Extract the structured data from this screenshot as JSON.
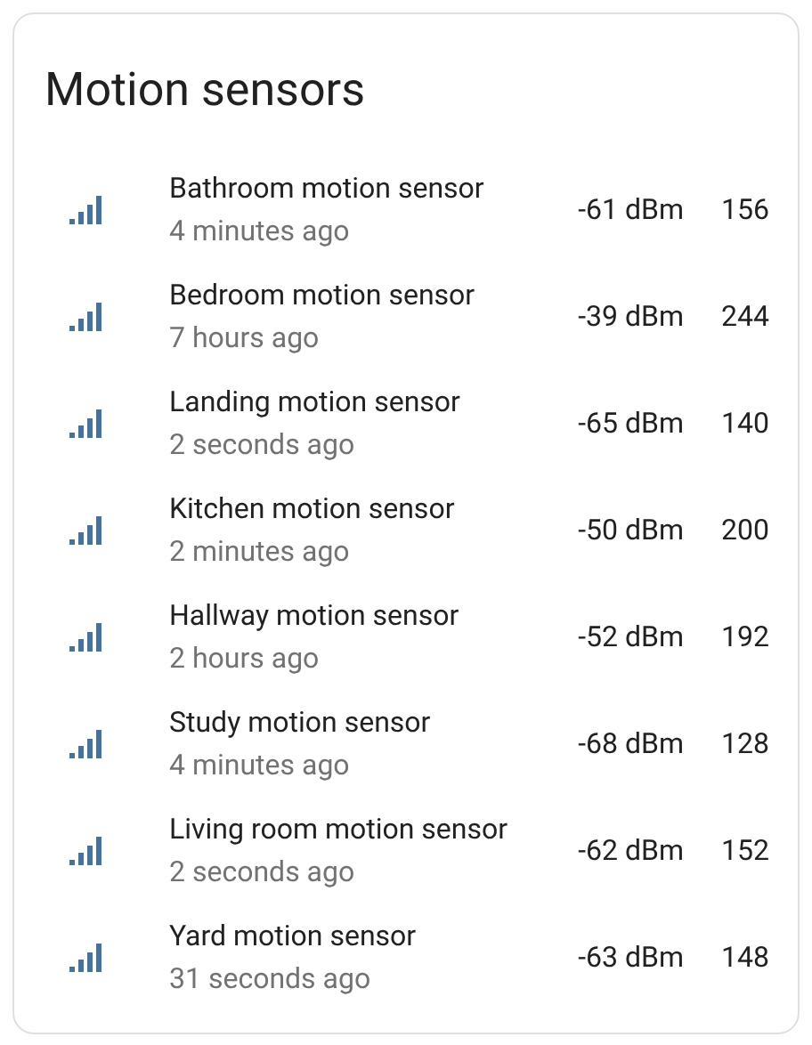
{
  "title": "Motion sensors",
  "sensors": [
    {
      "name": "Bathroom motion sensor",
      "time": "4 minutes ago",
      "signal": "-61 dBm",
      "value": "156"
    },
    {
      "name": "Bedroom motion sensor",
      "time": "7 hours ago",
      "signal": "-39 dBm",
      "value": "244"
    },
    {
      "name": "Landing motion sensor",
      "time": "2 seconds ago",
      "signal": "-65 dBm",
      "value": "140"
    },
    {
      "name": "Kitchen motion sensor",
      "time": "2 minutes ago",
      "signal": "-50 dBm",
      "value": "200"
    },
    {
      "name": "Hallway motion sensor",
      "time": "2 hours ago",
      "signal": "-52 dBm",
      "value": "192"
    },
    {
      "name": "Study motion sensor",
      "time": "4 minutes ago",
      "signal": "-68 dBm",
      "value": "128"
    },
    {
      "name": "Living room motion sensor",
      "time": "2 seconds ago",
      "signal": "-62 dBm",
      "value": "152"
    },
    {
      "name": "Yard motion sensor",
      "time": "31 seconds ago",
      "signal": "-63 dBm",
      "value": "148"
    }
  ]
}
